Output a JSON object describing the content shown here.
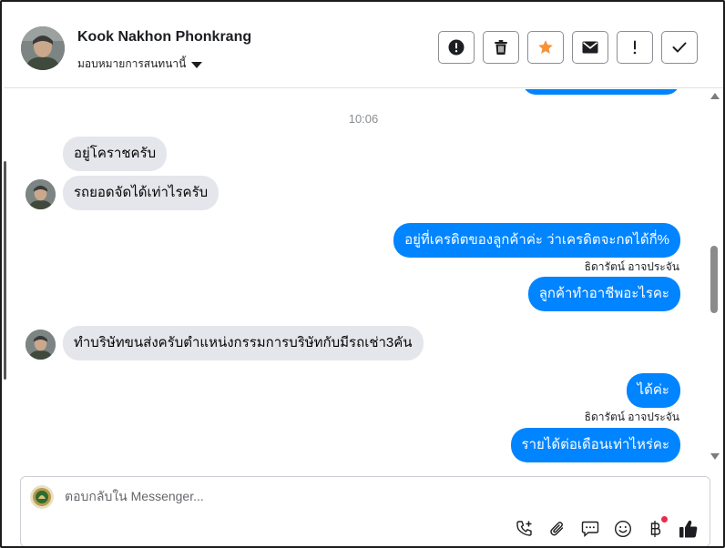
{
  "header": {
    "contact_name": "Kook Nakhon Phonkrang",
    "assign_label": "มอบหมายการสนทนานี้",
    "actions": [
      {
        "icon": "alert-circle-icon",
        "name": "spam-button"
      },
      {
        "icon": "trash-icon",
        "name": "delete-button"
      },
      {
        "icon": "star-icon",
        "name": "star-button"
      },
      {
        "icon": "envelope-icon",
        "name": "mark-unread-button"
      },
      {
        "icon": "exclamation-icon",
        "name": "follow-up-button"
      },
      {
        "icon": "check-icon",
        "name": "mark-done-button"
      }
    ],
    "star_color": "#f7923b"
  },
  "messages": {
    "timestamp": "10:06",
    "items": [
      {
        "direction": "in",
        "text": "อยู่โคราชครับ"
      },
      {
        "direction": "in",
        "text": "รถยอดจัดได้เท่าไรครับ"
      },
      {
        "direction": "out",
        "text": "อยู่ที่เครดิตของลูกค้าค่ะ ว่าเครดิตจะกดได้กี่%"
      },
      {
        "direction": "sender",
        "text": "ธิดารัตน์ อาจประจัน"
      },
      {
        "direction": "out",
        "text": "ลูกค้าทำอาชีพอะไรคะ"
      },
      {
        "direction": "in",
        "text": "ทำบริษัทขนส่งครับตำแหน่งกรรมการบริษัทกับมีรถเช่า3คัน"
      },
      {
        "direction": "out",
        "text": "ได้ค่ะ"
      },
      {
        "direction": "sender",
        "text": "ธิดารัตน์ อาจประจัน"
      },
      {
        "direction": "out",
        "text": "รายได้ต่อเดือนเท่าไหร่คะ"
      }
    ],
    "outgoing_color": "#0084ff",
    "incoming_color": "#e4e6eb"
  },
  "composer": {
    "placeholder": "ตอบกลับใน Messenger...",
    "tools": [
      "phone-add-icon",
      "paperclip-icon",
      "chat-bubble-icon",
      "smiley-icon",
      "baht-icon",
      "thumbs-up-icon"
    ]
  }
}
